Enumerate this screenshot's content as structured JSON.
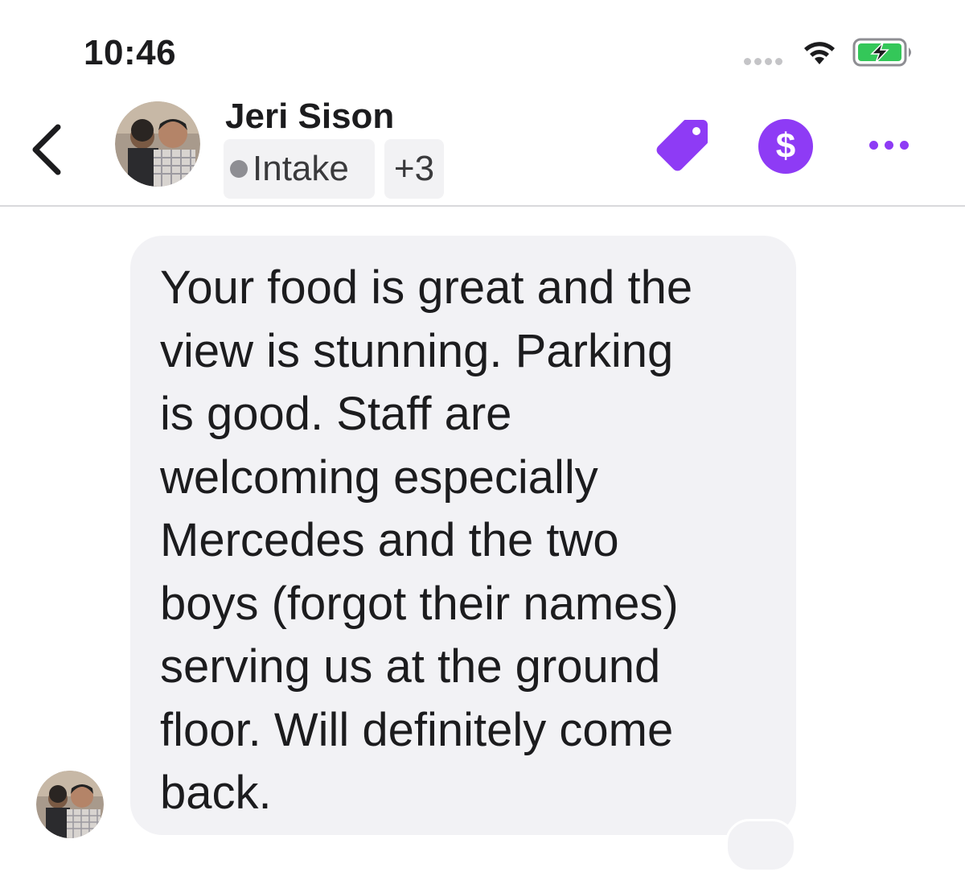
{
  "status_bar": {
    "time": "10:46"
  },
  "header": {
    "contact_name": "Jeri Sison",
    "stage_tag": "Intake",
    "extra_tags": "+3",
    "payment_symbol": "$",
    "icons": [
      "back-chevron-icon",
      "tag-icon",
      "dollar-icon",
      "more-dots-icon"
    ]
  },
  "conversation": {
    "messages": [
      {
        "direction": "incoming",
        "text": "Your food is great and the\nview is stunning. Parking\nis good. Staff are\nwelcoming especially\nMercedes and the two\nboys (forgot their names)\nserving us at the ground\nfloor. Will definitely come\nback."
      }
    ]
  },
  "colors": {
    "accent_purple": "#8e3bf5",
    "bubble_bg": "#f2f2f5",
    "battery_green": "#34c759"
  }
}
